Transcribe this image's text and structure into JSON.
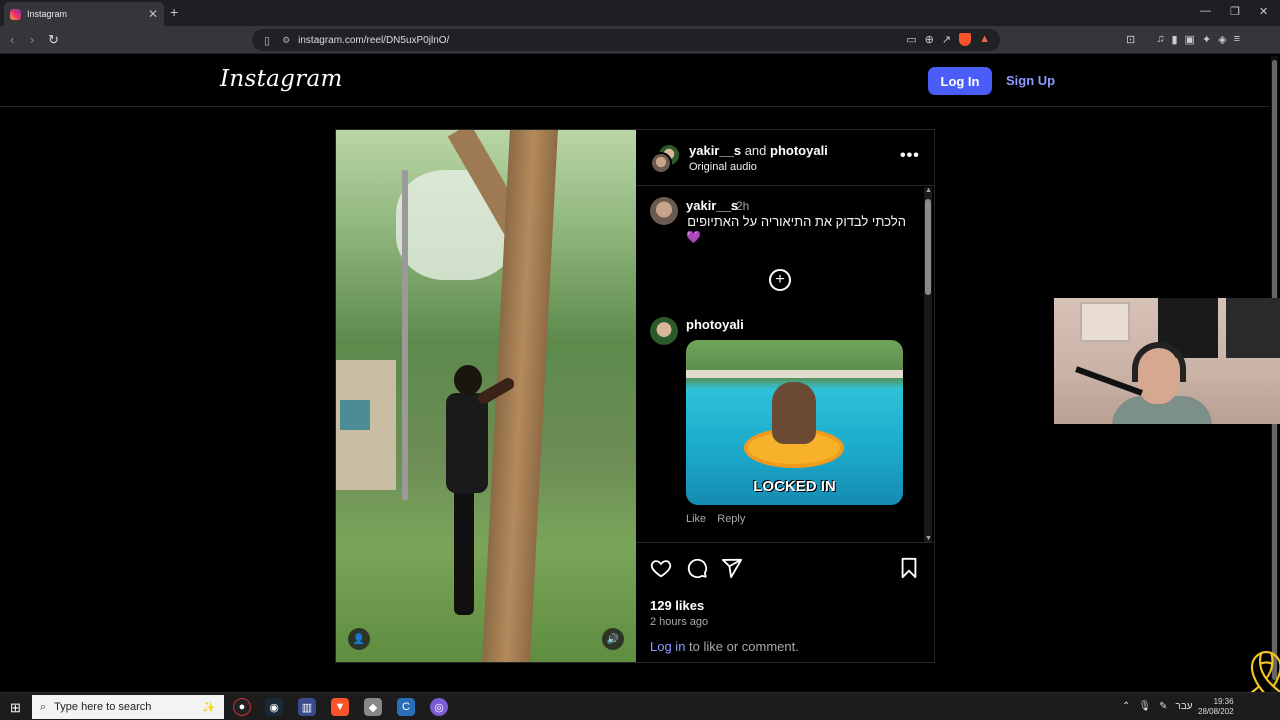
{
  "browser": {
    "tab_title": "Instagram",
    "tab_close": "✕",
    "new_tab": "+",
    "url": "instagram.com/reel/DN5uxP0jlnO/"
  },
  "instagram": {
    "logo": "Instagram",
    "login_button": "Log In",
    "signup_link": "Sign Up",
    "post": {
      "header_user1": "yakir__s",
      "header_conj": "and",
      "header_user2": "photoyali",
      "header_audio": "Original audio",
      "more_icon": "•••",
      "comment1": {
        "user": "yakir__s",
        "time": "2h",
        "text": "הלכתי לבדוק את התיאוריה על האתיופים",
        "emoji": "💜"
      },
      "load_more_icon": "+",
      "comment2": {
        "user": "photoyali",
        "gif_caption": "LOCKED IN",
        "like": "Like",
        "reply": "Reply"
      },
      "likes": "129 likes",
      "posted": "2 hours ago",
      "login_prompt_link": "Log in",
      "login_prompt_rest": " to like or comment."
    }
  },
  "taskbar": {
    "search_placeholder": "Type here to search",
    "time": "19:36",
    "date": "28/08/202",
    "lang": "עבר"
  },
  "colors": {
    "accent": "#4a5df9",
    "link": "#8c9bff",
    "ribbon": "#f3c623"
  }
}
